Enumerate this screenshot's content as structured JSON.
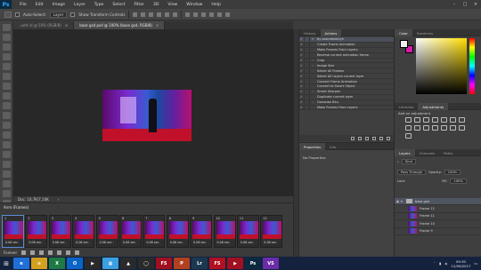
{
  "menubar": {
    "logo": "Ps",
    "items": [
      "File",
      "Edit",
      "Image",
      "Layer",
      "Type",
      "Select",
      "Filter",
      "3D",
      "View",
      "Window",
      "Help"
    ],
    "window_controls": [
      "–",
      "□",
      "×"
    ]
  },
  "options_bar": {
    "auto_select_label": "Auto-Select:",
    "auto_select_value": "Layer",
    "transform_controls_label": "Show Transform Controls"
  },
  "document_tabs": [
    {
      "label": "..oett id @ 50% (RGB/8)",
      "close": "×"
    },
    {
      "label": "base gsd.psd @ 100% (base gsd, RGB/8)",
      "close": "×"
    }
  ],
  "canvas": {
    "status_left": "Doc: 10,7K/7,10K",
    "status_right": "›"
  },
  "timeline": {
    "title": "Anm (Frames)",
    "frames": [
      {
        "num": "1",
        "delay": "0.06 sec."
      },
      {
        "num": "2",
        "delay": "0.06 sec."
      },
      {
        "num": "3",
        "delay": "0.06 sec."
      },
      {
        "num": "4",
        "delay": "0.06 sec."
      },
      {
        "num": "5",
        "delay": "0.06 sec."
      },
      {
        "num": "6",
        "delay": "0.06 sec."
      },
      {
        "num": "7",
        "delay": "0.06 sec."
      },
      {
        "num": "8",
        "delay": "0.06 sec."
      },
      {
        "num": "9",
        "delay": "0.06 sec."
      },
      {
        "num": "10",
        "delay": "0.06 sec."
      },
      {
        "num": "11",
        "delay": "0.06 sec."
      },
      {
        "num": "12",
        "delay": "0.06 sec."
      }
    ],
    "loop_label": "Forever"
  },
  "actions_panel": {
    "tabs": [
      "History",
      "Actions"
    ],
    "rows": [
      {
        "label": "by aasimblebhyh",
        "type": "head"
      },
      {
        "label": "Create Frame Animation"
      },
      {
        "label": "Make Frames From Layers"
      },
      {
        "label": "Reverse current animation  frame"
      },
      {
        "label": "Crop"
      },
      {
        "label": "Image Size"
      },
      {
        "label": "Select All Frames"
      },
      {
        "label": "Select All Layers current layer"
      },
      {
        "label": "Convert Frame Animation"
      },
      {
        "label": "Convert to Smart Object"
      },
      {
        "label": "Smart Sharpen"
      },
      {
        "label": "Duplicate current layer"
      },
      {
        "label": "Gaussian Blur"
      },
      {
        "label": "Make Frames From Layers"
      }
    ]
  },
  "properties_panel": {
    "tabs": [
      "Properties",
      "Info"
    ],
    "body": "No Properties"
  },
  "color_panel": {
    "tabs": [
      "Color",
      "Swatches"
    ]
  },
  "adjustments_panel": {
    "tabs": [
      "Libraries",
      "Adjustments"
    ],
    "title": "Add an adjustment"
  },
  "layers_panel": {
    "tabs": [
      "Layers",
      "Channels",
      "Paths"
    ],
    "filter": "Kind",
    "blend_mode": "Pass Through",
    "opacity_label": "Opacity:",
    "opacity_value": "100%",
    "lock_label": "Lock:",
    "fill_label": "Fill:",
    "fill_value": "100%",
    "layers": [
      {
        "name": "base gsd",
        "type": "group"
      },
      {
        "name": "Frame 12"
      },
      {
        "name": "Frame 11"
      },
      {
        "name": "Frame 10"
      },
      {
        "name": "Frame 9"
      }
    ]
  },
  "taskbar": {
    "start_icon": "windows-icon",
    "apps": [
      {
        "label": "e",
        "color": "#1e6fd8"
      },
      {
        "label": "≡",
        "color": "#d4a020"
      },
      {
        "label": "X",
        "color": "#1d7a45"
      },
      {
        "label": "O",
        "color": "#0a64c8"
      },
      {
        "label": "▶",
        "color": "#2a2a2a"
      },
      {
        "label": "▦",
        "color": "#3aa0e0"
      },
      {
        "label": "▲",
        "color": "#2a2a2a"
      },
      {
        "label": "◯",
        "color": "#2a2a2a"
      },
      {
        "label": "FS",
        "color": "#a01020"
      },
      {
        "label": "P",
        "color": "#b04020"
      },
      {
        "label": "Lr",
        "color": "#1c3850"
      },
      {
        "label": "FS",
        "color": "#b01020"
      },
      {
        "label": "▶",
        "color": "#a01020"
      },
      {
        "label": "Ps",
        "color": "#0b2a40"
      },
      {
        "label": "VS",
        "color": "#6a2ca8"
      }
    ],
    "time": "09:30",
    "date": "12/09/2017"
  }
}
